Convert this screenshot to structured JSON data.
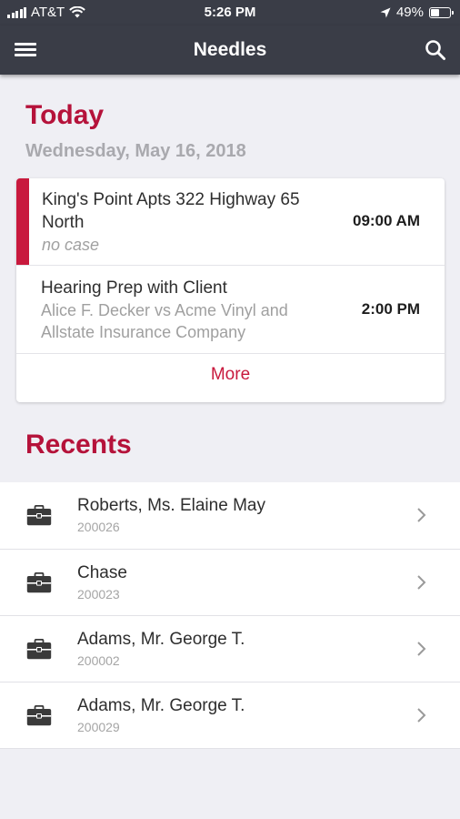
{
  "status_bar": {
    "carrier": "AT&T",
    "time": "5:26 PM",
    "battery": "49%",
    "battery_level": 0.49
  },
  "header": {
    "title": "Needles",
    "menu_icon": "hamburger-menu-icon",
    "search_icon": "search-icon"
  },
  "today": {
    "heading": "Today",
    "date": "Wednesday, May 16, 2018",
    "events": [
      {
        "title": "King's Point Apts 322 Highway 65 North",
        "subtitle": "no case",
        "time": "09:00 AM"
      },
      {
        "title": "Hearing Prep with Client",
        "subtitle": "Alice F. Decker vs Acme Vinyl and Allstate Insurance Company",
        "time": "2:00 PM"
      }
    ],
    "more_label": "More"
  },
  "recents": {
    "heading": "Recents",
    "items": [
      {
        "name": "Roberts, Ms. Elaine May",
        "case_number": "200026"
      },
      {
        "name": "Chase",
        "case_number": "200023"
      },
      {
        "name": "Adams, Mr. George T.",
        "case_number": "200002"
      },
      {
        "name": "Adams, Mr. George T.",
        "case_number": "200029"
      }
    ]
  },
  "colors": {
    "accent": "#c8193d",
    "nav_background": "#3a3d47",
    "page_background": "#efeff4"
  }
}
